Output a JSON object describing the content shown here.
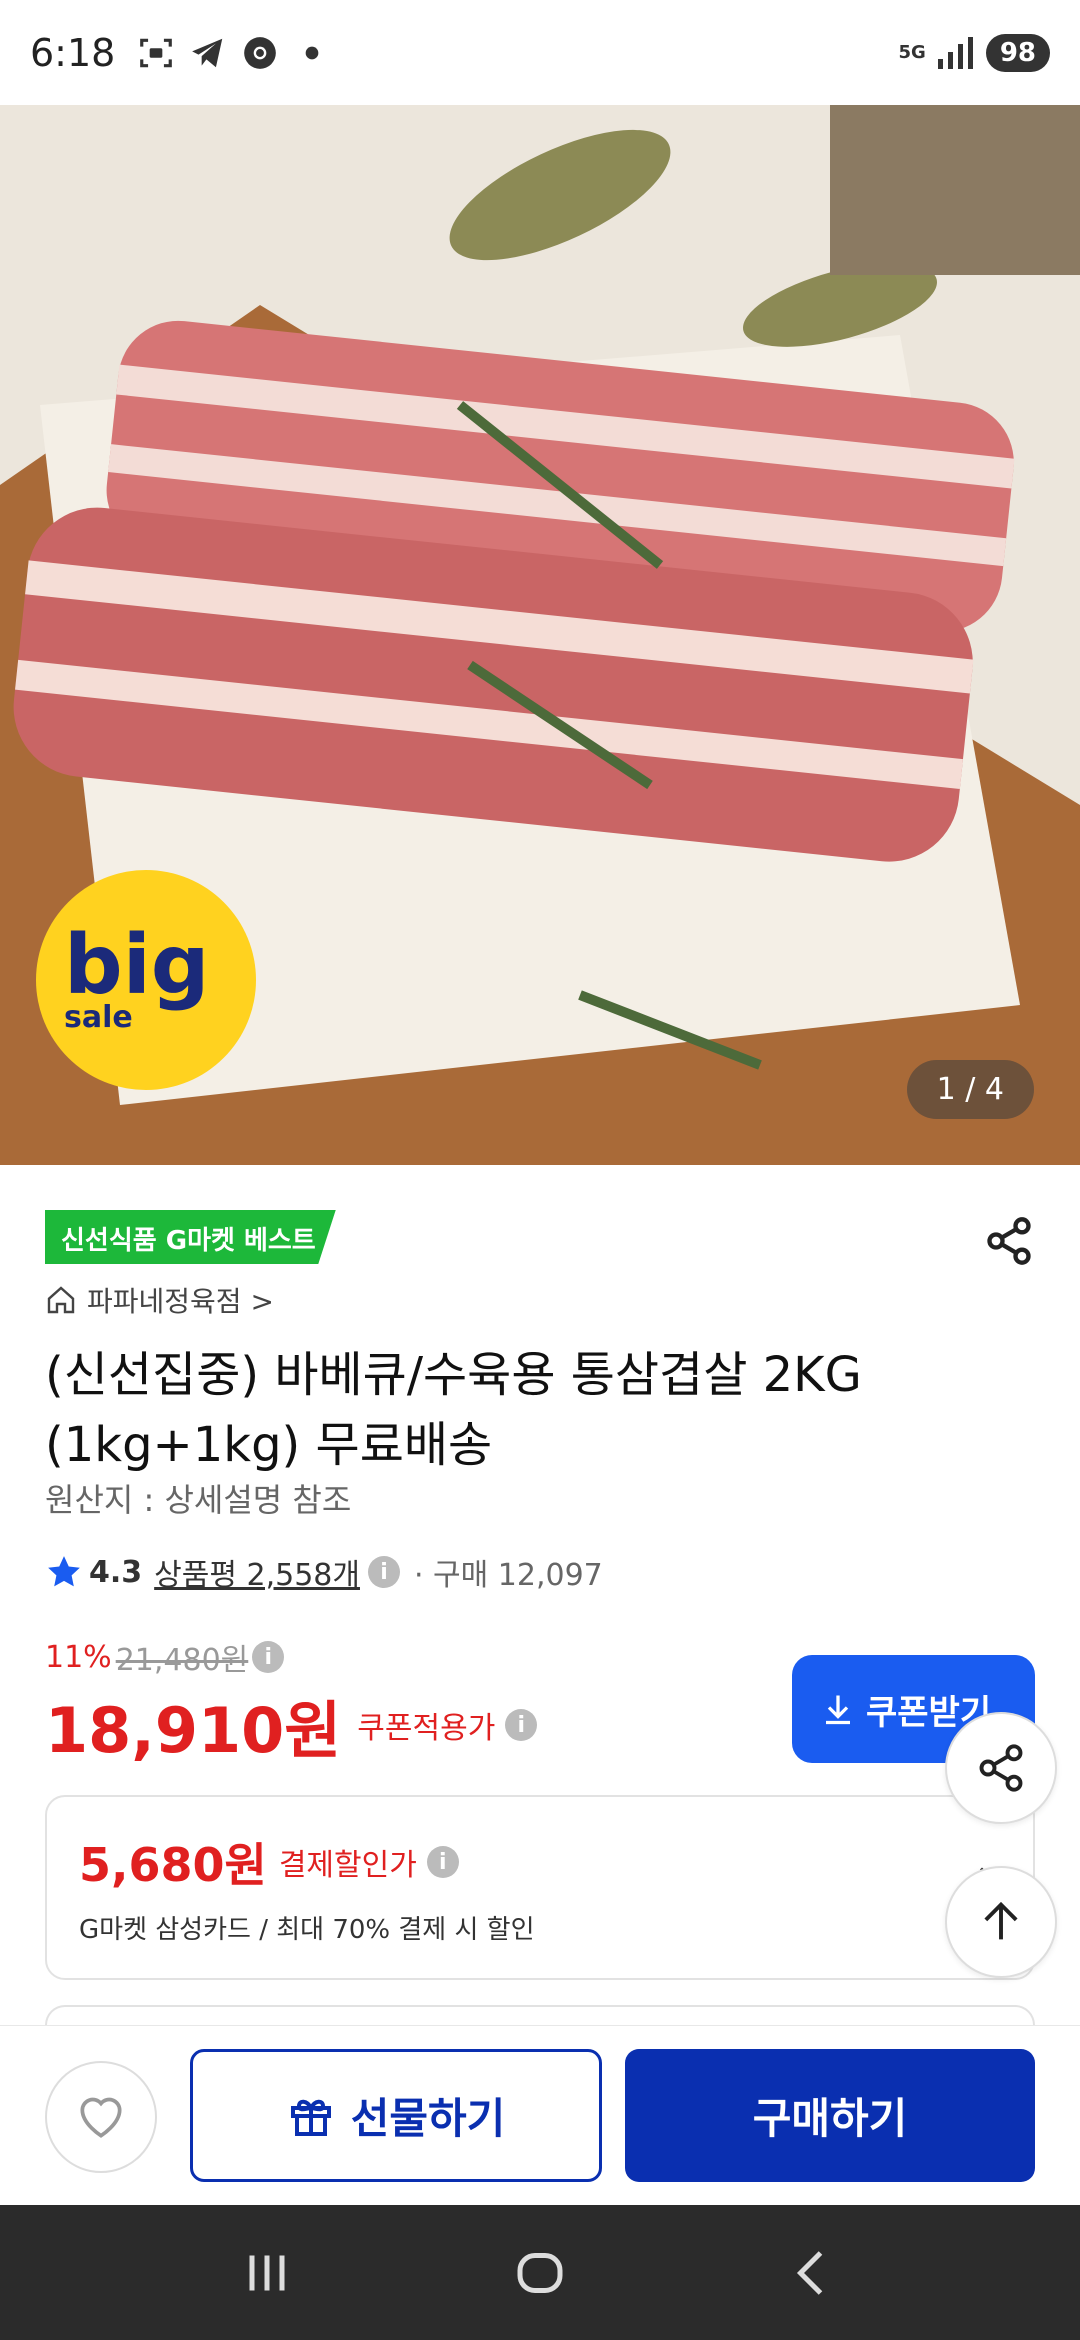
{
  "status_bar": {
    "time": "6:18",
    "network": "5G",
    "battery": "98"
  },
  "product_image": {
    "badge_big": "big",
    "badge_sale": "sale",
    "counter": "1 / 4"
  },
  "product": {
    "best_badge": "신선식품 G마켓 베스트",
    "shop_name": "파파네정육점 >",
    "title": "(신선집중) 바베큐/수육용 통삼겹살 2KG (1kg+1kg) 무료배송",
    "origin": "원산지 : 상세설명 참조",
    "rating": "4.3",
    "review_label": "상품평 2,558개",
    "purchase_label": "· 구매 12,097"
  },
  "price": {
    "discount_rate": "11%",
    "original_price": "21,480원",
    "sale_price": "18,910원",
    "coupon_label": "쿠폰적용가",
    "coupon_button": "쿠폰받기"
  },
  "card_discount": {
    "amount": "5,680원",
    "label": "결제할인가",
    "description": "G마켓 삼성카드 / 최대 70% 결제 시 할인"
  },
  "actions": {
    "gift_label": "선물하기",
    "buy_label": "구매하기"
  },
  "icons": {
    "share": "share-icon",
    "top": "arrow-up-icon",
    "wish": "heart-icon",
    "gift": "gift-icon",
    "home": "home-icon",
    "star": "star-icon"
  },
  "colors": {
    "brand_blue": "#0a2fb0",
    "coupon_blue": "#1a5cf0",
    "price_red": "#e02020",
    "badge_green": "#1db83a"
  }
}
